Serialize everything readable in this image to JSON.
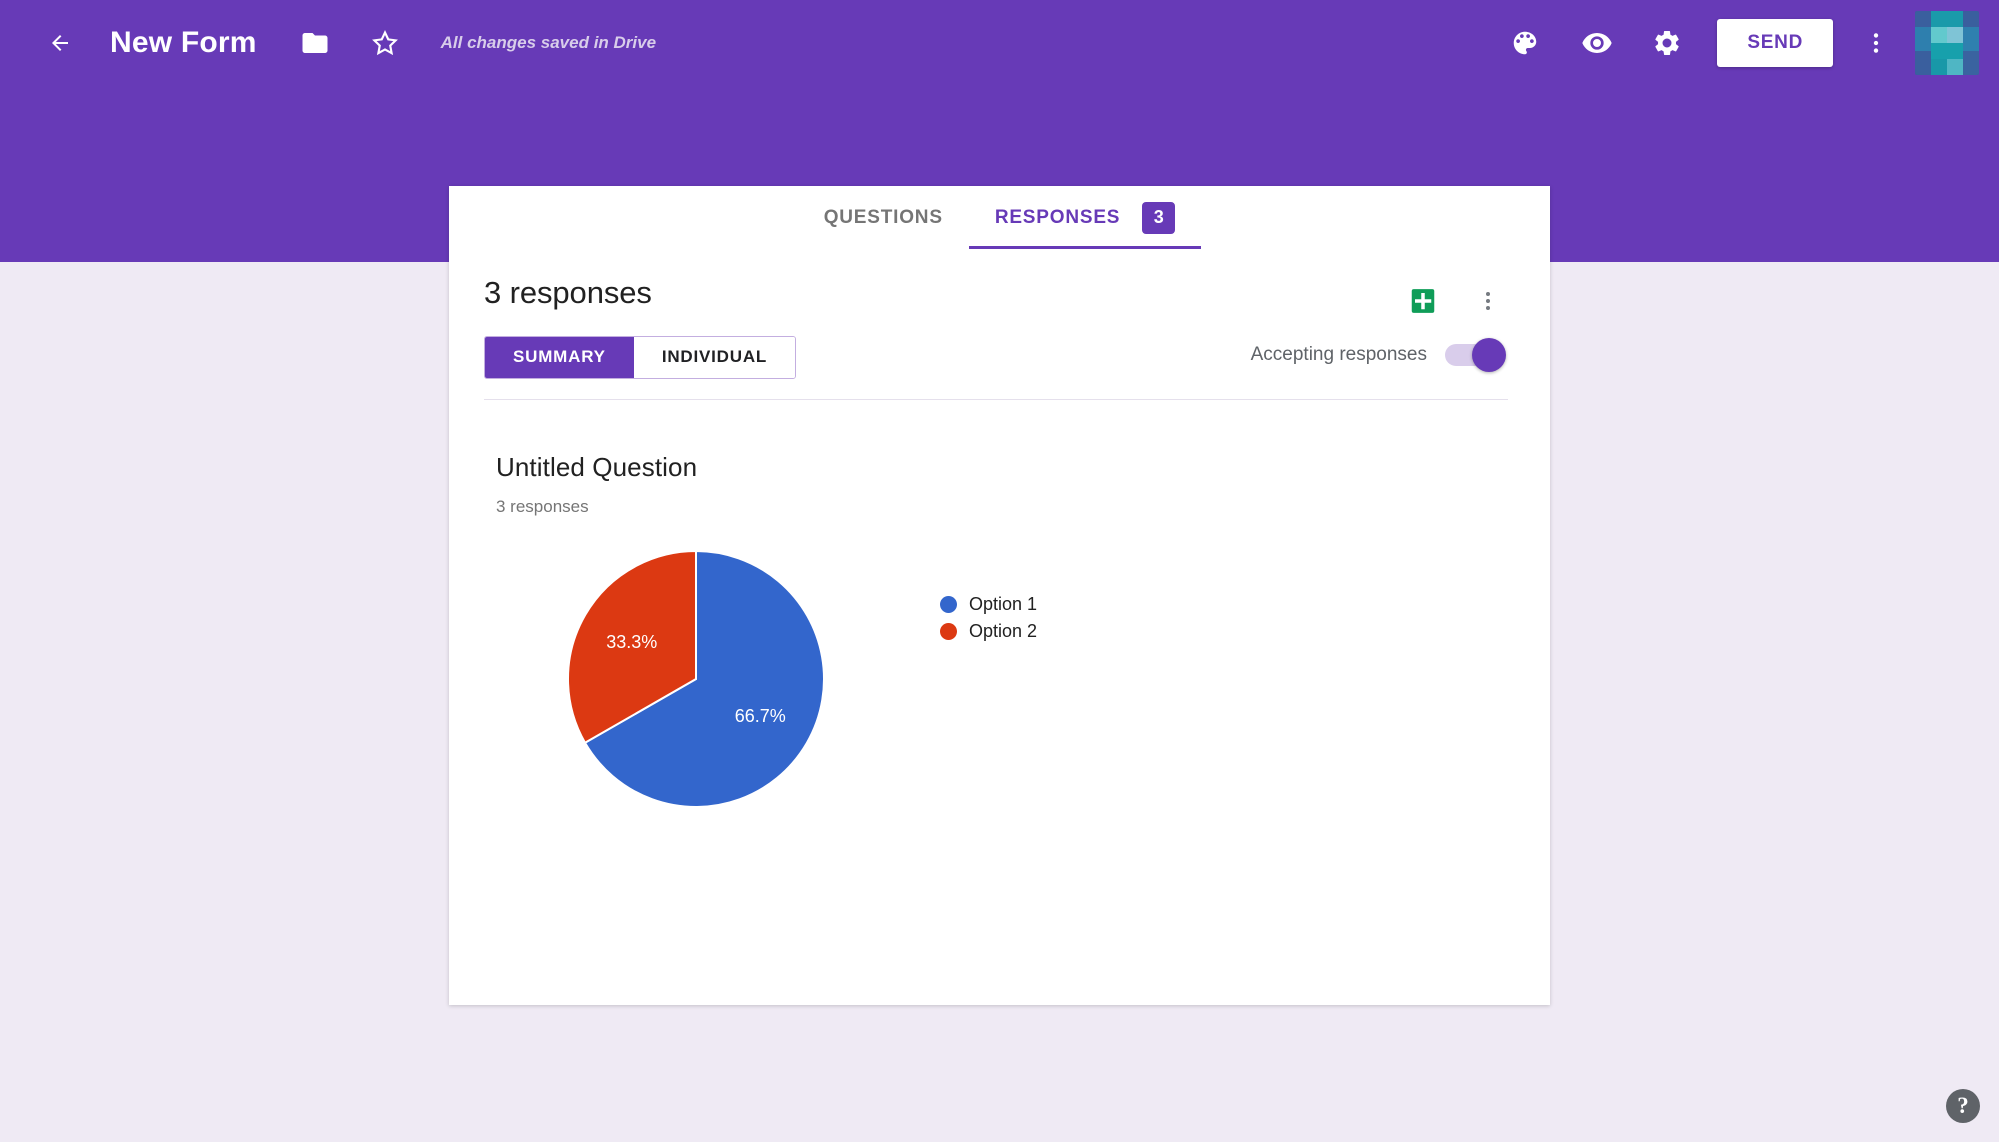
{
  "app": {
    "title": "New Form",
    "save_status": "All changes saved in Drive",
    "back_icon": "back-arrow-icon",
    "folder_icon": "folder-icon",
    "star_icon": "star-outline-icon",
    "palette_icon": "palette-icon",
    "preview_icon": "eye-preview-icon",
    "settings_icon": "gear-settings-icon",
    "send_label": "SEND",
    "overflow_icon": "more-vert-icon",
    "avatar_icon": "user-avatar",
    "theme_color": "#673AB7",
    "page_background": "#efeaf4"
  },
  "tabs": [
    {
      "label": "QUESTIONS",
      "active": false
    },
    {
      "label": "RESPONSES",
      "active": true
    }
  ],
  "tab_badge": "3",
  "responses": {
    "count_title": "3 responses",
    "sheets_icon": "google-sheets-icon",
    "overflow_icon": "more-vert-icon",
    "view_toggle": [
      {
        "label": "SUMMARY",
        "selected": true
      },
      {
        "label": "INDIVIDUAL",
        "selected": false
      }
    ],
    "accepting_label": "Accepting responses",
    "accepting_state": "on"
  },
  "question": {
    "title": "Untitled Question",
    "response_count": "3 responses"
  },
  "help": {
    "label": "?"
  },
  "chart_data": {
    "type": "pie",
    "title": "Untitled Question",
    "subtitle": "3 responses",
    "categories": [
      "Option 1",
      "Option 2"
    ],
    "values": [
      66.7,
      33.3
    ],
    "value_labels": [
      "66.7%",
      "33.3%"
    ],
    "counts": [
      2,
      1
    ],
    "total_responses": 3,
    "colors": [
      "#3366cc",
      "#dc3912"
    ],
    "legend": {
      "position": "right",
      "entries": [
        {
          "label": "Option 1",
          "color": "#3366cc",
          "value": 66.7
        },
        {
          "label": "Option 2",
          "color": "#dc3912",
          "value": 33.3
        }
      ]
    },
    "label_color": "#ffffff",
    "grid": false
  }
}
